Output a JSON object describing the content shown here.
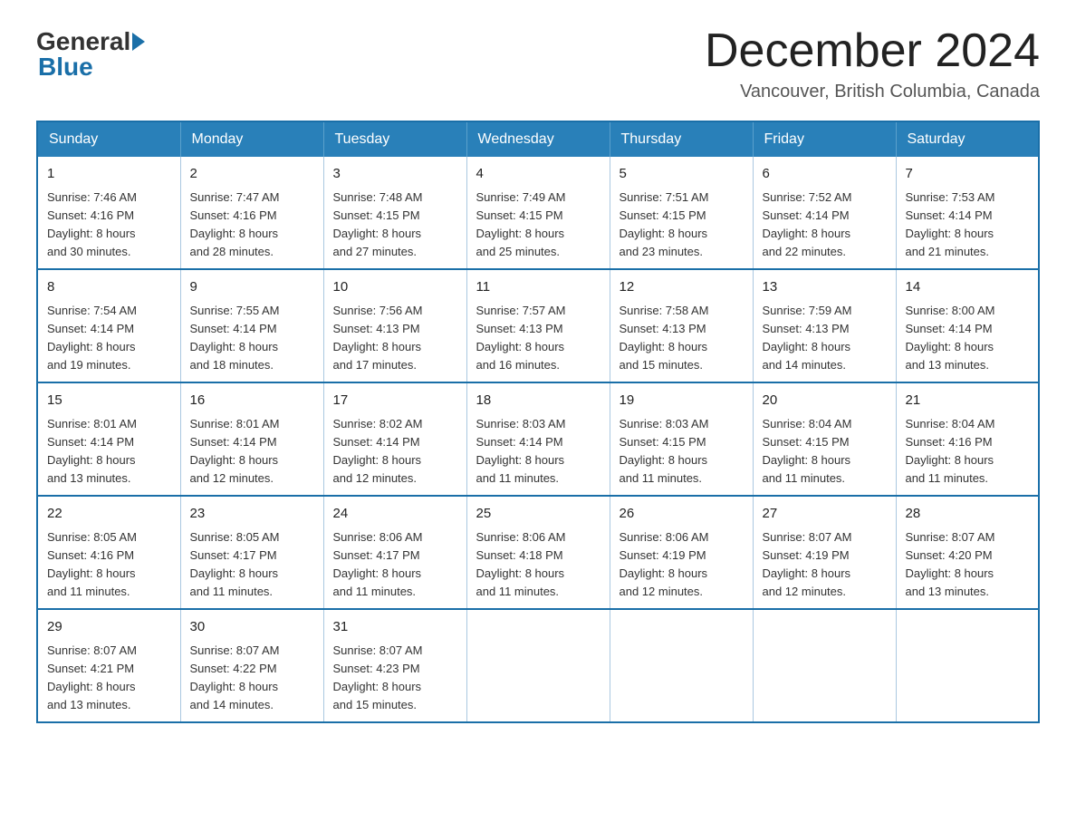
{
  "logo": {
    "general": "General",
    "blue": "Blue"
  },
  "title": {
    "month_year": "December 2024",
    "location": "Vancouver, British Columbia, Canada"
  },
  "days_of_week": [
    "Sunday",
    "Monday",
    "Tuesday",
    "Wednesday",
    "Thursday",
    "Friday",
    "Saturday"
  ],
  "weeks": [
    [
      {
        "day": "1",
        "sunrise": "7:46 AM",
        "sunset": "4:16 PM",
        "daylight": "8 hours and 30 minutes."
      },
      {
        "day": "2",
        "sunrise": "7:47 AM",
        "sunset": "4:16 PM",
        "daylight": "8 hours and 28 minutes."
      },
      {
        "day": "3",
        "sunrise": "7:48 AM",
        "sunset": "4:15 PM",
        "daylight": "8 hours and 27 minutes."
      },
      {
        "day": "4",
        "sunrise": "7:49 AM",
        "sunset": "4:15 PM",
        "daylight": "8 hours and 25 minutes."
      },
      {
        "day": "5",
        "sunrise": "7:51 AM",
        "sunset": "4:15 PM",
        "daylight": "8 hours and 23 minutes."
      },
      {
        "day": "6",
        "sunrise": "7:52 AM",
        "sunset": "4:14 PM",
        "daylight": "8 hours and 22 minutes."
      },
      {
        "day": "7",
        "sunrise": "7:53 AM",
        "sunset": "4:14 PM",
        "daylight": "8 hours and 21 minutes."
      }
    ],
    [
      {
        "day": "8",
        "sunrise": "7:54 AM",
        "sunset": "4:14 PM",
        "daylight": "8 hours and 19 minutes."
      },
      {
        "day": "9",
        "sunrise": "7:55 AM",
        "sunset": "4:14 PM",
        "daylight": "8 hours and 18 minutes."
      },
      {
        "day": "10",
        "sunrise": "7:56 AM",
        "sunset": "4:13 PM",
        "daylight": "8 hours and 17 minutes."
      },
      {
        "day": "11",
        "sunrise": "7:57 AM",
        "sunset": "4:13 PM",
        "daylight": "8 hours and 16 minutes."
      },
      {
        "day": "12",
        "sunrise": "7:58 AM",
        "sunset": "4:13 PM",
        "daylight": "8 hours and 15 minutes."
      },
      {
        "day": "13",
        "sunrise": "7:59 AM",
        "sunset": "4:13 PM",
        "daylight": "8 hours and 14 minutes."
      },
      {
        "day": "14",
        "sunrise": "8:00 AM",
        "sunset": "4:14 PM",
        "daylight": "8 hours and 13 minutes."
      }
    ],
    [
      {
        "day": "15",
        "sunrise": "8:01 AM",
        "sunset": "4:14 PM",
        "daylight": "8 hours and 13 minutes."
      },
      {
        "day": "16",
        "sunrise": "8:01 AM",
        "sunset": "4:14 PM",
        "daylight": "8 hours and 12 minutes."
      },
      {
        "day": "17",
        "sunrise": "8:02 AM",
        "sunset": "4:14 PM",
        "daylight": "8 hours and 12 minutes."
      },
      {
        "day": "18",
        "sunrise": "8:03 AM",
        "sunset": "4:14 PM",
        "daylight": "8 hours and 11 minutes."
      },
      {
        "day": "19",
        "sunrise": "8:03 AM",
        "sunset": "4:15 PM",
        "daylight": "8 hours and 11 minutes."
      },
      {
        "day": "20",
        "sunrise": "8:04 AM",
        "sunset": "4:15 PM",
        "daylight": "8 hours and 11 minutes."
      },
      {
        "day": "21",
        "sunrise": "8:04 AM",
        "sunset": "4:16 PM",
        "daylight": "8 hours and 11 minutes."
      }
    ],
    [
      {
        "day": "22",
        "sunrise": "8:05 AM",
        "sunset": "4:16 PM",
        "daylight": "8 hours and 11 minutes."
      },
      {
        "day": "23",
        "sunrise": "8:05 AM",
        "sunset": "4:17 PM",
        "daylight": "8 hours and 11 minutes."
      },
      {
        "day": "24",
        "sunrise": "8:06 AM",
        "sunset": "4:17 PM",
        "daylight": "8 hours and 11 minutes."
      },
      {
        "day": "25",
        "sunrise": "8:06 AM",
        "sunset": "4:18 PM",
        "daylight": "8 hours and 11 minutes."
      },
      {
        "day": "26",
        "sunrise": "8:06 AM",
        "sunset": "4:19 PM",
        "daylight": "8 hours and 12 minutes."
      },
      {
        "day": "27",
        "sunrise": "8:07 AM",
        "sunset": "4:19 PM",
        "daylight": "8 hours and 12 minutes."
      },
      {
        "day": "28",
        "sunrise": "8:07 AM",
        "sunset": "4:20 PM",
        "daylight": "8 hours and 13 minutes."
      }
    ],
    [
      {
        "day": "29",
        "sunrise": "8:07 AM",
        "sunset": "4:21 PM",
        "daylight": "8 hours and 13 minutes."
      },
      {
        "day": "30",
        "sunrise": "8:07 AM",
        "sunset": "4:22 PM",
        "daylight": "8 hours and 14 minutes."
      },
      {
        "day": "31",
        "sunrise": "8:07 AM",
        "sunset": "4:23 PM",
        "daylight": "8 hours and 15 minutes."
      },
      null,
      null,
      null,
      null
    ]
  ],
  "cell_labels": {
    "sunrise": "Sunrise:",
    "sunset": "Sunset:",
    "daylight": "Daylight:"
  }
}
